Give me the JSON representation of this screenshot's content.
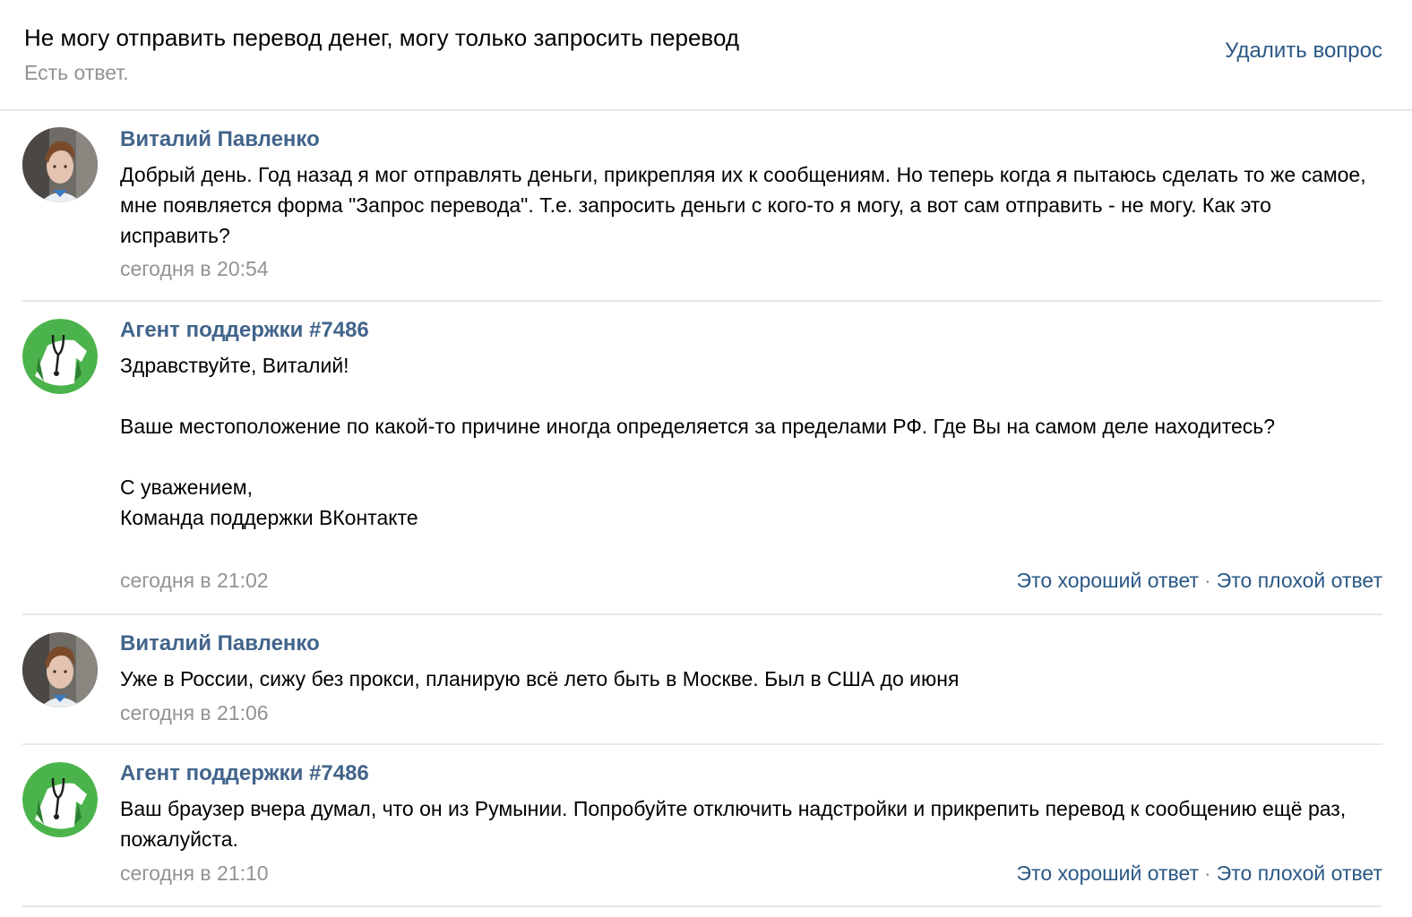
{
  "question": {
    "title": "Не могу отправить перевод денег, могу только запросить перевод",
    "status": "Есть ответ.",
    "delete_label": "Удалить вопрос"
  },
  "rating": {
    "good_label": "Это хороший ответ",
    "separator": "·",
    "bad_label": "Это плохой ответ"
  },
  "messages": [
    {
      "author": "Виталий Павленко",
      "avatar": "user-photo",
      "lines": [
        "Добрый день. Год назад я мог отправлять деньги, прикрепляя их к сообщениям. Но теперь когда я пытаюсь сделать то же самое, мне появляется форма \"Запрос перевода\". Т.е. запросить деньги с кого-то я могу, а вот сам отправить - не могу. Как это исправить?"
      ],
      "time": "сегодня в 20:54"
    },
    {
      "author": "Агент поддержки #7486",
      "avatar": "support-agent-icon",
      "lines": [
        "Здравствуйте, Виталий!",
        "Ваше местоположение по какой-то причине иногда определяется за пределами РФ. Где Вы на самом деле находитесь?",
        "С уважением,",
        "Команда поддержки ВКонтакте"
      ],
      "time": "сегодня в 21:02"
    },
    {
      "author": "Виталий Павленко",
      "avatar": "user-photo",
      "lines": [
        "Уже в России, сижу без прокси, планирую всё лето быть в Москве. Был в США до июня"
      ],
      "time": "сегодня в 21:06"
    },
    {
      "author": "Агент поддержки #7486",
      "avatar": "support-agent-icon",
      "lines": [
        "Ваш браузер вчера думал, что он из Румынии. Попробуйте отключить надстройки и прикрепить перевод к сообщению ещё раз, пожалуйста."
      ],
      "time": "сегодня в 21:10"
    }
  ],
  "colors": {
    "link": "#2a5885",
    "author": "#42648b",
    "muted": "#939393",
    "divider": "#e7e8ec",
    "agent_green": "#4bb34b"
  }
}
